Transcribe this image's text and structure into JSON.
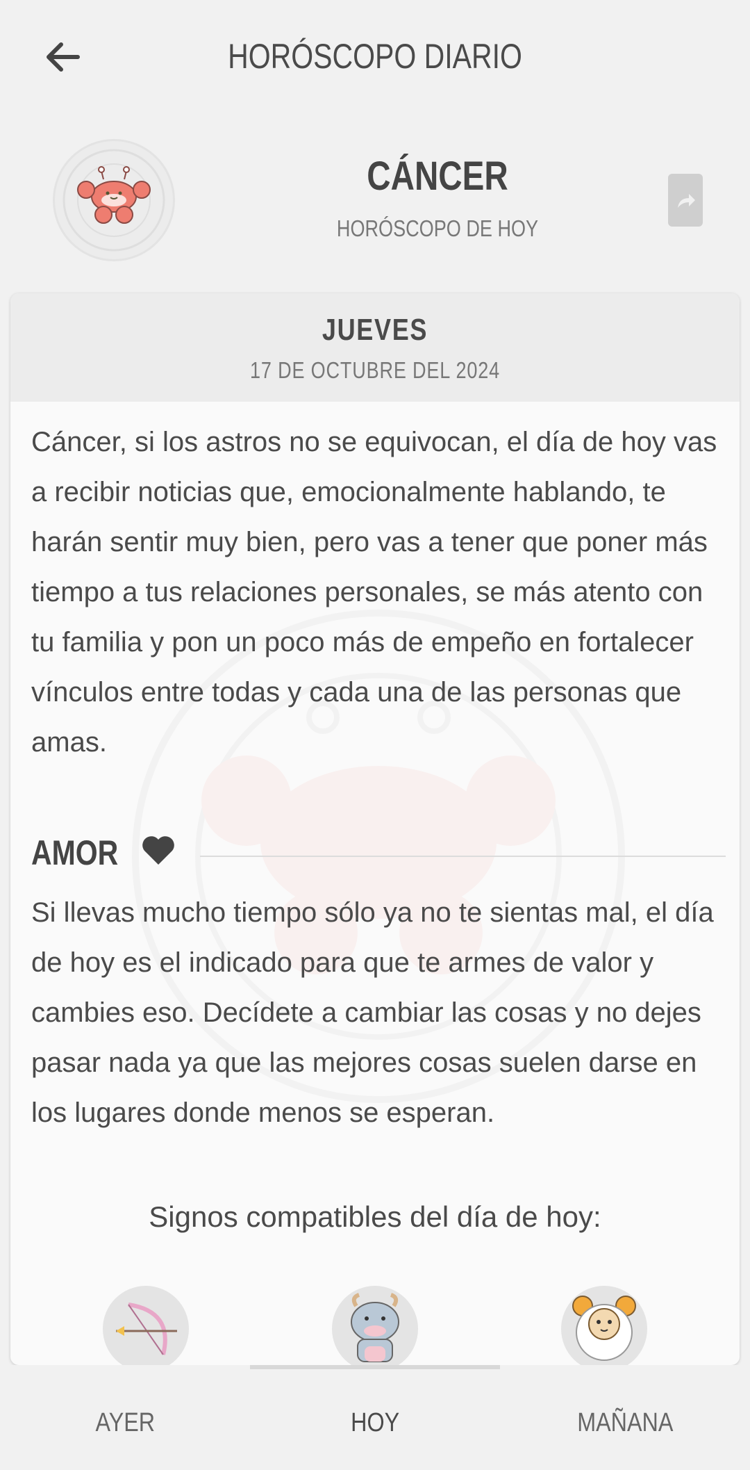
{
  "header": {
    "title": "HORÓSCOPO DIARIO",
    "back_icon": "arrow-left-icon"
  },
  "sign": {
    "name": "CÁNCER",
    "subtitle": "HORÓSCOPO DE HOY",
    "icon": "crab-icon",
    "share_icon": "share-icon"
  },
  "card": {
    "day": "JUEVES",
    "date": "17 DE OCTUBRE DEL 2024",
    "general_text": "Cáncer, si los astros no se equivocan, el día de hoy vas a recibir noticias que, emocionalmente hablando, te harán sentir muy bien, pero vas a tener que poner más tiempo a tus relaciones personales, se más atento con tu familia y pon un poco más de empeño en fortalecer vínculos entre todas y cada una de las personas que amas.",
    "love": {
      "title": "AMOR",
      "icon": "heart-icon",
      "text": "Si llevas mucho tiempo sólo ya no te sientas mal, el día de hoy es el indicado para que te armes de valor y cambies eso. Decídete a cambiar las cosas y no dejes pasar nada ya que las mejores cosas suelen darse en los lugares donde menos se esperan."
    },
    "compatible_label": "Signos compatibles del día de hoy:",
    "compatible_signs": [
      "sagittarius-icon",
      "taurus-icon",
      "aries-icon"
    ]
  },
  "nav": {
    "items": [
      "AYER",
      "HOY",
      "MAÑANA"
    ],
    "active": "HOY"
  },
  "colors": {
    "background": "#f1f1f1",
    "card": "#fafafa",
    "card_header": "#ececec",
    "text": "#4a4a4a",
    "crab": "#ee7d70"
  }
}
